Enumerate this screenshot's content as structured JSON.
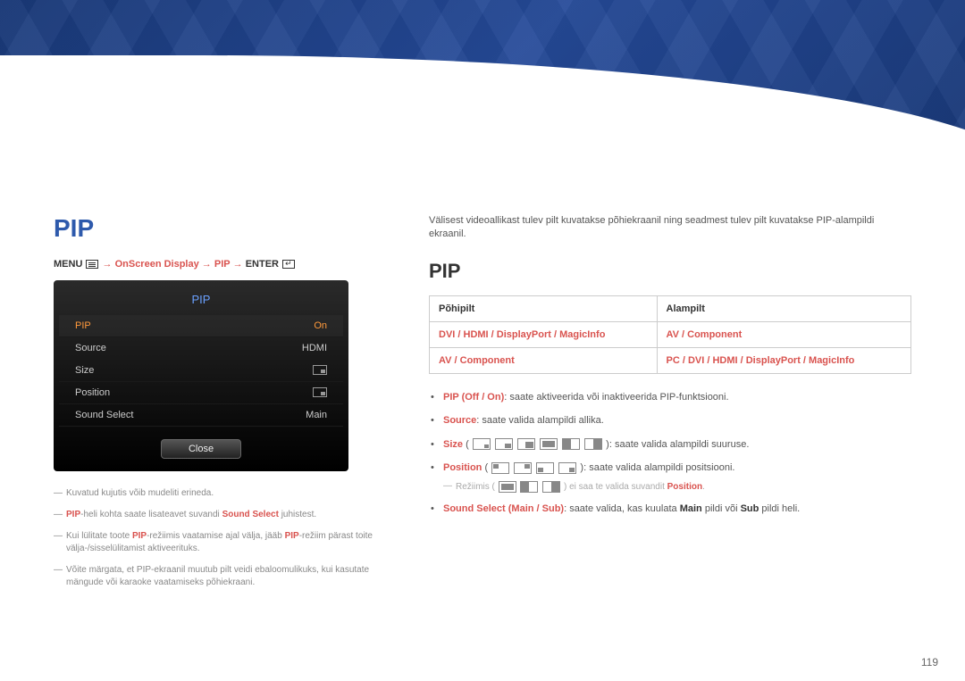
{
  "header": {
    "title": "OnScreen Display"
  },
  "left": {
    "section_title": "PIP",
    "breadcrumb": {
      "menu": "MENU",
      "arrow": " → ",
      "p1": "OnScreen Display",
      "p2": "PIP",
      "enter": "ENTER"
    },
    "osd": {
      "title": "PIP",
      "rows": [
        {
          "label": "PIP",
          "value": "On",
          "active": true
        },
        {
          "label": "Source",
          "value": "HDMI"
        },
        {
          "label": "Size",
          "value_icon": true
        },
        {
          "label": "Position",
          "value_icon": true
        },
        {
          "label": "Sound Select",
          "value": "Main"
        }
      ],
      "close": "Close"
    },
    "notes": {
      "n1": "Kuvatud kujutis võib mudeliti erineda.",
      "n2_pre": "PIP",
      "n2_mid": "-heli kohta saate lisateavet suvandi ",
      "n2_ss": "Sound Select",
      "n2_post": " juhistest.",
      "n3_a": "Kui lülitate toote ",
      "n3_b": "-režiimis vaatamise ajal välja, jääb ",
      "n3_c": "-režiim pärast toite välja-/sisselülitamist aktiveerituks.",
      "n4": "Võite märgata, et PIP-ekraanil muutub pilt veidi ebaloomulikuks, kui kasutate mängude või karaoke vaatamiseks põhiekraani."
    }
  },
  "right": {
    "intro": "Välisest videoallikast tulev pilt kuvatakse põhiekraanil ning seadmest tulev pilt kuvatakse PIP-alampildi ekraanil.",
    "sub_title": "PIP",
    "table": {
      "h1": "Põhipilt",
      "h2": "Alampilt",
      "r1c1": "DVI / HDMI / DisplayPort / MagicInfo",
      "r1c2": "AV / Component",
      "r2c1": "AV / Component",
      "r2c2": "PC / DVI / HDMI / DisplayPort / MagicInfo"
    },
    "bullets": {
      "b1_lead": "PIP",
      "b1_paren": " (Off / On)",
      "b1_rest": ": saate aktiveerida või inaktiveerida PIP-funktsiooni.",
      "b2_lead": "Source",
      "b2_rest": ": saate valida alampildi allika.",
      "b3_lead": "Size",
      "b3_rest": ": saate valida alampildi suuruse.",
      "b4_lead": "Position",
      "b4_rest": ": saate valida alampildi positsiooni.",
      "b4_sub_a": "Režiimis (",
      "b4_sub_b": ") ei saa te valida suvandit ",
      "b4_sub_pos": "Position",
      "b5_lead": "Sound Select",
      "b5_paren_a": " (Main / Sub)",
      "b5_mid": ": saate valida, kas kuulata ",
      "b5_main": "Main",
      "b5_mid2": " pildi või ",
      "b5_sub": "Sub",
      "b5_end": " pildi heli."
    }
  },
  "page_num": "119"
}
